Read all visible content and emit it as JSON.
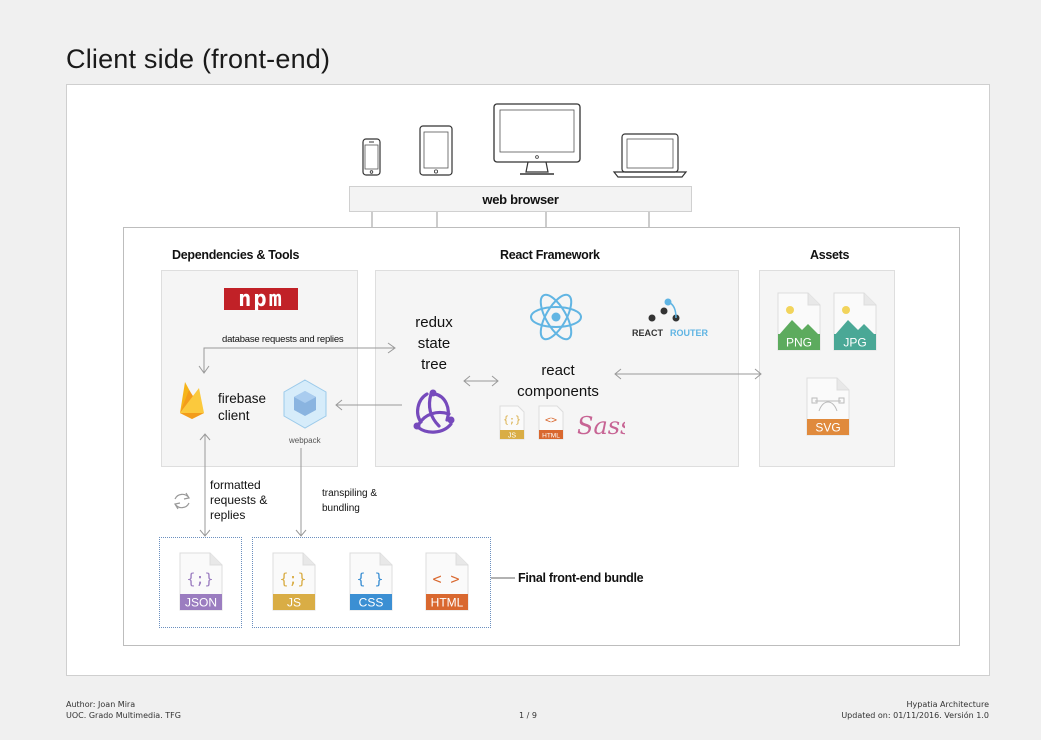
{
  "page": {
    "title": "Client side (front-end)"
  },
  "devices": [
    "phone-icon",
    "tablet-icon",
    "desktop-monitor-icon",
    "laptop-icon"
  ],
  "browser": {
    "label": "web browser"
  },
  "sections": {
    "dependencies": "Dependencies & Tools",
    "react": "React Framework",
    "assets": "Assets"
  },
  "dependencies": {
    "npm_logo": "npm",
    "db_label": "database requests and replies",
    "firebase_label": "firebase client",
    "firebase_line1": "firebase",
    "firebase_line2": "client",
    "webpack_label": "webpack"
  },
  "react": {
    "redux_line1": "redux",
    "redux_line2": "state",
    "redux_line3": "tree",
    "components_line1": "react",
    "components_line2": "components",
    "router_logo_a": "REACT",
    "router_logo_b": "ROUTER",
    "mini_js": "JS",
    "mini_html": "HTML",
    "sass_logo": "Sass"
  },
  "assets": {
    "png": "PNG",
    "jpg": "JPG",
    "svg": "SVG"
  },
  "flows": {
    "formatted_line1": "formatted",
    "formatted_line2": "requests &",
    "formatted_line3": "replies",
    "transpile_line1": "transpiling &",
    "transpile_line2": "bundling"
  },
  "bundle": {
    "json": "JSON",
    "js": "JS",
    "css": "CSS",
    "html": "HTML",
    "label": "Final front-end bundle"
  },
  "footer": {
    "author": "Author: Joan Mira",
    "org": "UOC. Grado Multimedia. TFG",
    "page_num": "1 / 9",
    "doc_title": "Hypatia Architecture",
    "updated": "Updated on: 01/11/2016. Versión 1.0"
  },
  "colors": {
    "npm_red": "#c12127",
    "react_blue": "#61b5e3",
    "redux_purple": "#764abc",
    "firebase_yellow": "#f6b41a",
    "webpack_blue": "#8ed6fb",
    "json_purple": "#9b7dc0",
    "js_yellow": "#d9ad45",
    "css_blue": "#3b8fd3",
    "html_orange": "#d9682f",
    "png_green": "#5dab5e",
    "jpg_teal": "#4aa896",
    "svg_orange": "#e08a3c",
    "sass_pink": "#c76494"
  }
}
